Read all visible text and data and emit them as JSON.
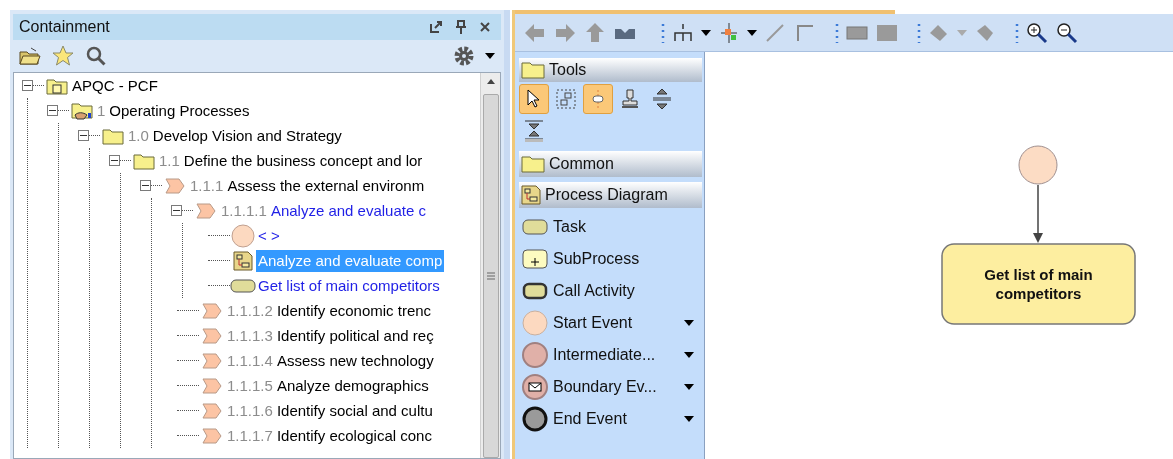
{
  "containment": {
    "title": "Containment"
  },
  "tree": [
    {
      "kind": "model",
      "name": "APQC - PCF",
      "color": "#000000",
      "selected": false,
      "expanded": true,
      "children": [
        {
          "kind": "shared-package",
          "number": "1",
          "name": "Operating Processes",
          "color": "#000000",
          "selected": false,
          "expanded": true,
          "children": [
            {
              "kind": "package",
              "number": "1.0",
              "name": "Develop Vision and Strategy",
              "color": "#000000",
              "selected": false,
              "expanded": true,
              "children": [
                {
                  "kind": "package",
                  "number": "1.1",
                  "name": "Define the business concept and lor",
                  "color": "#000000",
                  "selected": false,
                  "expanded": true,
                  "children": [
                    {
                      "kind": "process",
                      "number": "1.1.1",
                      "name": "Assess the external environm",
                      "color": "#000000",
                      "selected": false,
                      "expanded": true,
                      "children": [
                        {
                          "kind": "process",
                          "number": "1.1.1.1",
                          "name": "Analyze and evaluate c",
                          "color": "#1f1fe6",
                          "selected": false,
                          "expanded": true,
                          "children": [
                            {
                              "kind": "start-event",
                              "name": "< >",
                              "color": "#1f1fe6",
                              "selected": false
                            },
                            {
                              "kind": "diagram",
                              "name": "Analyze and evaluate comp",
                              "selected": true
                            },
                            {
                              "kind": "task",
                              "name": "Get list of main competitors",
                              "color": "#1f1fe6",
                              "selected": false
                            }
                          ]
                        },
                        {
                          "kind": "process",
                          "number": "1.1.1.2",
                          "name": "Identify economic trenc",
                          "color": "#000000",
                          "selected": false
                        },
                        {
                          "kind": "process",
                          "number": "1.1.1.3",
                          "name": "Identify political and reç",
                          "color": "#000000",
                          "selected": false
                        },
                        {
                          "kind": "process",
                          "number": "1.1.1.4",
                          "name": "Assess new technology",
                          "color": "#000000",
                          "selected": false
                        },
                        {
                          "kind": "process",
                          "number": "1.1.1.5",
                          "name": "Analyze demographics",
                          "color": "#000000",
                          "selected": false
                        },
                        {
                          "kind": "process",
                          "number": "1.1.1.6",
                          "name": "Identify social and cultu",
                          "color": "#000000",
                          "selected": false
                        },
                        {
                          "kind": "process",
                          "number": "1.1.1.7",
                          "name": "Identify ecological conc",
                          "color": "#000000",
                          "selected": false
                        }
                      ]
                    }
                  ]
                }
              ]
            }
          ]
        }
      ]
    }
  ],
  "palette": {
    "tools_header": "Tools",
    "tools": [
      {
        "kind": "pointer",
        "selected": true
      },
      {
        "kind": "marquee",
        "selected": false
      },
      {
        "kind": "connector",
        "selected": true
      },
      {
        "kind": "stamp",
        "selected": false
      },
      {
        "kind": "split",
        "selected": false
      },
      {
        "kind": "join",
        "selected": false
      }
    ],
    "groups": [
      {
        "kind": "folder",
        "label": "Common"
      },
      {
        "kind": "diagram",
        "label": "Process Diagram"
      }
    ],
    "items": [
      {
        "kind": "task",
        "label": "Task",
        "dropdown": false
      },
      {
        "kind": "subprocess",
        "label": "SubProcess",
        "dropdown": false
      },
      {
        "kind": "call-activity",
        "label": "Call Activity",
        "dropdown": false
      },
      {
        "kind": "start-event",
        "label": "Start Event",
        "dropdown": true
      },
      {
        "kind": "intermediate-event",
        "label": "Intermediate...",
        "dropdown": true
      },
      {
        "kind": "boundary-event",
        "label": "Boundary Ev...",
        "dropdown": true
      },
      {
        "kind": "end-event",
        "label": "End Event",
        "dropdown": true
      }
    ]
  },
  "diagram": {
    "task_label": "Get list of main competitors"
  }
}
